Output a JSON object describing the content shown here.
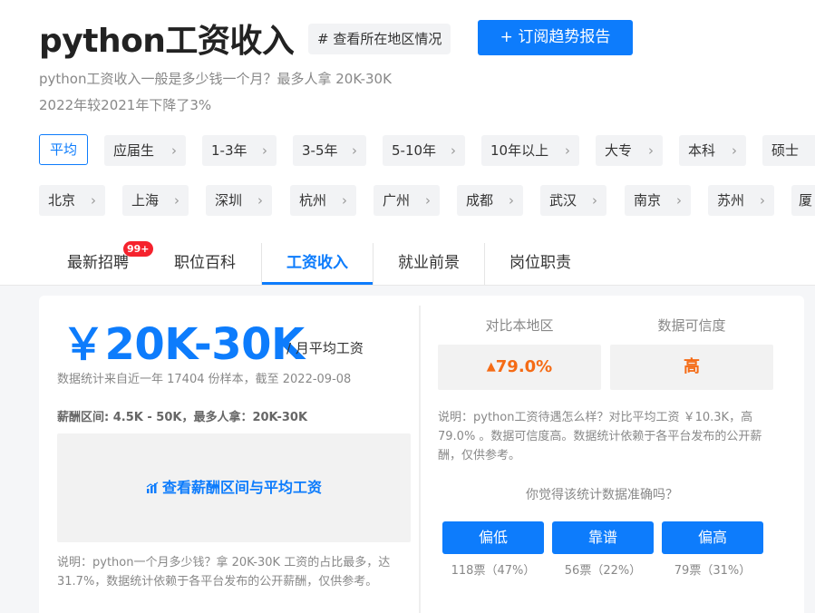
{
  "header": {
    "title": "python工资收入",
    "region_button": "# 查看所在地区情况",
    "subscribe_button": "+ 订阅趋势报告",
    "subtitle_1": "python工资收入一般是多少钱一个月？最多人拿 20K-30K",
    "subtitle_2": "2022年较2021年下降了3%"
  },
  "experience_filters": [
    "平均",
    "应届生",
    "1-3年",
    "3-5年",
    "5-10年",
    "10年以上",
    "大专",
    "本科",
    "硕士"
  ],
  "city_filters": [
    "北京",
    "上海",
    "深圳",
    "杭州",
    "广州",
    "成都",
    "武汉",
    "南京",
    "苏州",
    "厦"
  ],
  "chevron": "›",
  "tabs": [
    "最新招聘",
    "职位百科",
    "工资收入",
    "就业前景",
    "岗位职责"
  ],
  "new_badge": "99+",
  "salary": {
    "amount": "￥20K-30K",
    "unit": "/ 月平均工资",
    "stat_note": "数据统计来自近一年 17404 份样本，截至 2022-09-08",
    "range_note": "薪酬区间: 4.5K - 50K，最多人拿：20K-30K",
    "chart_link": "查看薪酬区间与平均工资",
    "chart_icon": "bar-chart-icon",
    "description": "说明：python一个月多少钱？拿 20K-30K 工资的占比最多，达 31.7%，数据统计依赖于各平台发布的公开薪酬，仅供参考。"
  },
  "comparison": {
    "compare_label": "对比本地区",
    "compare_value": "79.0%",
    "compare_icon": "up-arrow-icon",
    "trust_label": "数据可信度",
    "trust_value": "高",
    "description": "说明：python工资待遇怎么样？对比平均工资 ￥10.3K，高 79.0% 。数据可信度高。数据统计依赖于各平台发布的公开薪酬，仅供参考。",
    "question": "你觉得该统计数据准确吗？",
    "votes": [
      {
        "label": "偏低",
        "count": "118票（47%）"
      },
      {
        "label": "靠谱",
        "count": "56票（22%）"
      },
      {
        "label": "偏高",
        "count": "79票（31%）"
      }
    ]
  },
  "colors": {
    "accent": "#0d7cfc",
    "highlight": "#f56b15",
    "badge": "#f5222d"
  }
}
